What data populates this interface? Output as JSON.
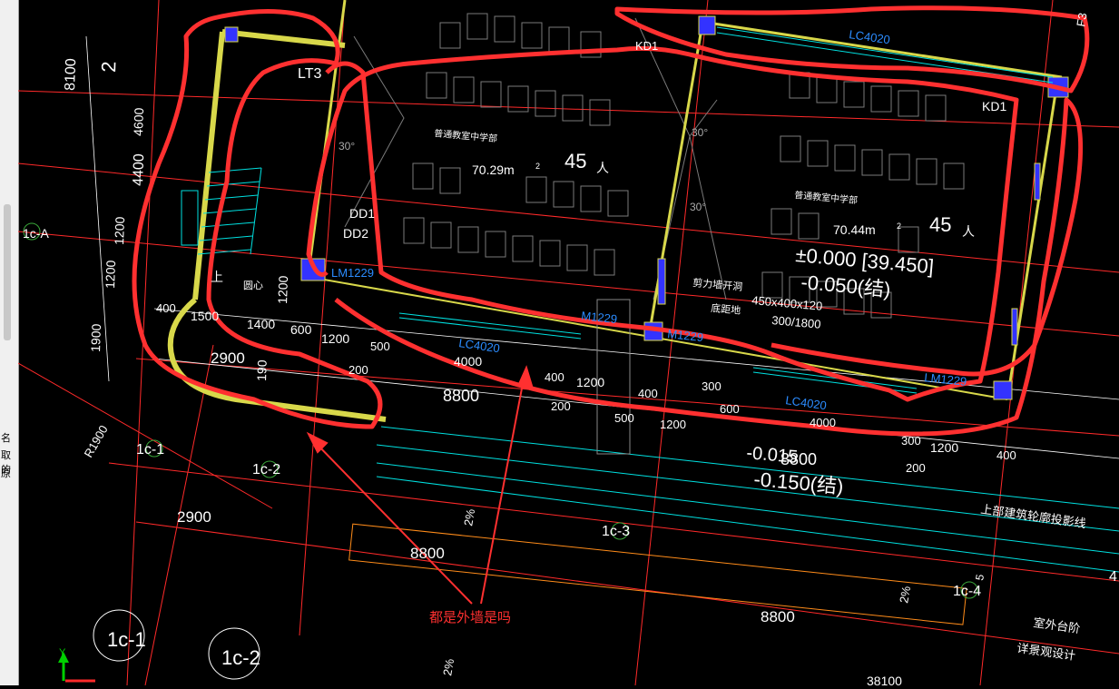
{
  "colors": {
    "background": "#000000",
    "grid": "#ff2a2a",
    "dim_text": "#ffffff",
    "wall": "#d8d84a",
    "window_text": "#2b8cff",
    "annotation": "#ff2a2a",
    "column": "#3333ff",
    "stair": "#00e0e0"
  },
  "sidebar": {
    "captions": [
      "名",
      "取的",
      "原"
    ]
  },
  "axes": {
    "1c-A": "1c-A",
    "1c-1": "1c-1",
    "1c-2": "1c-2",
    "1c-3": "1c-3",
    "1c-4": "1c-4",
    "bubble_1": "1c-1",
    "bubble_2": "1c-2"
  },
  "left_dims": [
    "8100",
    "2",
    "4600",
    "4400",
    "1200",
    "1200",
    "1900",
    "1900"
  ],
  "rooms": {
    "left": {
      "name": "普通教室中学部",
      "area": "70.29m",
      "area_sup": "2",
      "capacity": "45",
      "unit": "人"
    },
    "right": {
      "name": "普通教室中学部",
      "area": "70.44m",
      "area_sup": "2",
      "capacity": "45",
      "unit": "人"
    }
  },
  "labels": {
    "lt3": "LT3",
    "dd1": "DD1",
    "dd2": "DD2",
    "kd1_top": "KD1",
    "kd1_right": "KD1",
    "m1229_left": "LM1229",
    "m1229_mid": "M1229",
    "m1229_mid2": "M1229",
    "lm1229_right": "LM1229",
    "lc4020_top": "LC4020",
    "lc4020_mid": "LC4020",
    "lc4020_right": "LC4020",
    "wall_opening": "剪力墙开洞",
    "wall_opening_size": "450x400x120",
    "sill_height": "底距地",
    "sill_value": "300/1800",
    "stair_up": "上",
    "round_center": "圆心",
    "elev_main": "±0.000 [39.450]",
    "elev_struct": "-0.050(结)",
    "elev_lower": "-0.015",
    "elev_lower2": "-0.150(结)",
    "dim_8800_b": "8800",
    "upper_outline": "上部建筑轮廓投影线",
    "outdoor_step": "室外台阶",
    "landscape": "详景观设计",
    "r1900": "R1900",
    "slope1": "2%",
    "slope2": "2%",
    "slope3": "2%",
    "angle1": "30°",
    "angle2": "30°",
    "angle3": "30°",
    "f3": "F3",
    "num_4": "4",
    "dim_38100": "38100",
    "v_mark": "5"
  },
  "dims": {
    "d400": "400",
    "d1500": "1500",
    "d1400": "1400",
    "d600": "600",
    "d1200a": "1200",
    "d500": "500",
    "d2900": "2900",
    "d200": "200",
    "d4000a": "4000",
    "d8800": "8800",
    "d400b": "400",
    "d200b": "200",
    "d1200b": "1200",
    "d500b": "500",
    "d400c": "400",
    "d300": "300",
    "d1200c": "1200",
    "d600b": "600",
    "d4000b": "4000",
    "d8800b": "8800",
    "d300b": "300",
    "d1200d": "1200",
    "d200c": "200",
    "d400d": "400",
    "d2900b": "2900",
    "d8800c": "8800",
    "d8800d": "8800",
    "d190": "190",
    "d1200e": "1200",
    "d1200f": "1200"
  },
  "annotation": {
    "question": "都是外墙是吗"
  },
  "ucs": {
    "y": "Y"
  }
}
